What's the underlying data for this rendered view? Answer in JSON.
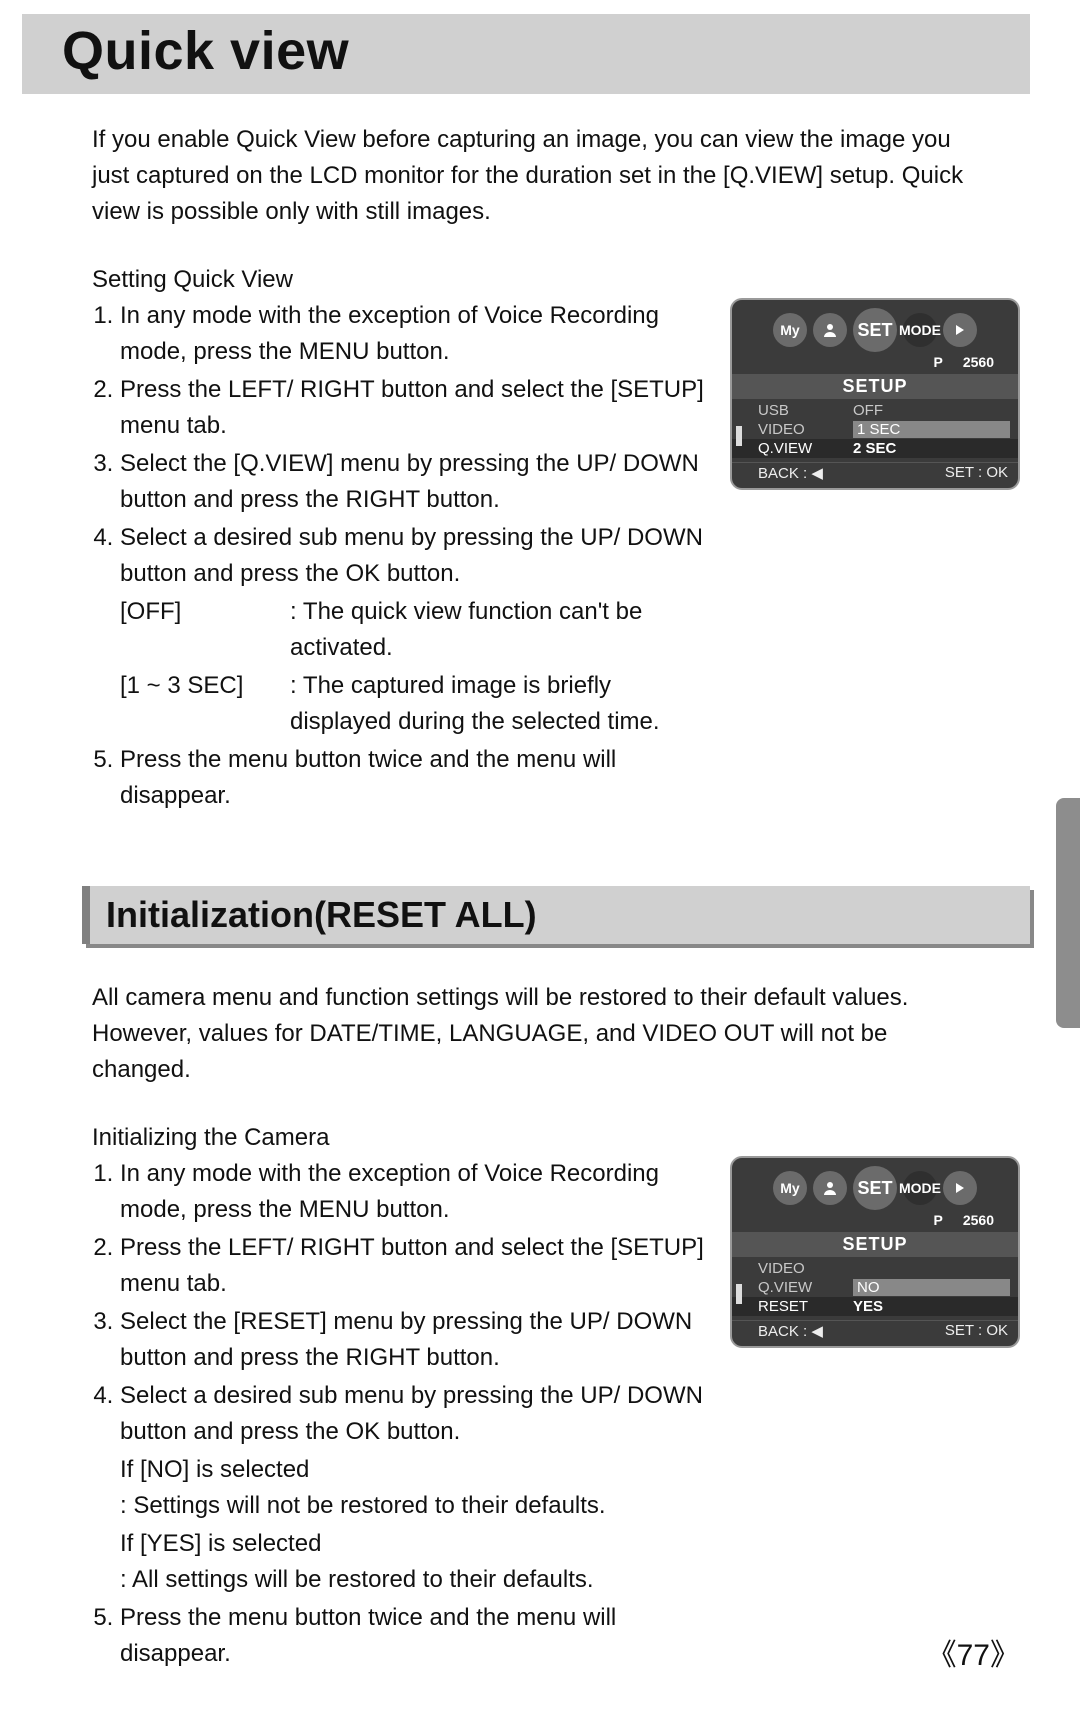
{
  "page_number": "77",
  "section1": {
    "title": "Quick view",
    "intro": "If you enable Quick View before capturing an image, you can view the image you just captured on the LCD monitor for the duration set in the [Q.VIEW] setup. Quick view is possible only with still images.",
    "subtitle": "Setting Quick View",
    "steps": [
      "In any mode with the exception of Voice Recording mode, press the MENU button.",
      "Press the LEFT/ RIGHT button and select the [SETUP] menu tab.",
      "Select the [Q.VIEW] menu by pressing the UP/ DOWN button and press the RIGHT button.",
      "Select a desired sub menu by pressing the UP/ DOWN button and press the OK button.",
      "Press the menu button twice and the menu will disappear."
    ],
    "options": [
      {
        "key": "[OFF]",
        "desc": ": The quick view function can't be activated."
      },
      {
        "key": "[1 ~ 3 SEC]",
        "desc": ": The captured image is briefly displayed during the selected time."
      }
    ]
  },
  "section2": {
    "title": "Initialization(RESET ALL)",
    "intro": "All camera menu and function settings will be restored to their default values. However, values for DATE/TIME, LANGUAGE, and VIDEO OUT will not be changed.",
    "subtitle": "Initializing the Camera",
    "steps": [
      "In any mode with the exception of Voice Recording mode, press the MENU button.",
      "Press the LEFT/ RIGHT button and select the [SETUP] menu tab.",
      "Select the [RESET] menu by pressing the UP/ DOWN button and press the RIGHT button.",
      "Select a desired sub menu by pressing the UP/ DOWN button and press the OK button.",
      "Press the menu button twice and the menu will disappear."
    ],
    "options": [
      {
        "key": "If [NO] is selected",
        "desc": ": Settings will not be restored to their defaults."
      },
      {
        "key": "If [YES] is selected",
        "desc": ": All settings will be restored to their defaults."
      }
    ]
  },
  "lcd1": {
    "set": "SET",
    "mode": "MODE",
    "p": "P",
    "res": "2560",
    "header": "SETUP",
    "rows": [
      {
        "k": "USB",
        "v": "OFF"
      },
      {
        "k": "VIDEO",
        "v": "1 SEC"
      },
      {
        "k": "Q.VIEW",
        "v": "2 SEC"
      }
    ],
    "back": "BACK : ◀",
    "setok": "SET : OK"
  },
  "lcd2": {
    "set": "SET",
    "mode": "MODE",
    "p": "P",
    "res": "2560",
    "header": "SETUP",
    "rows": [
      {
        "k": "VIDEO",
        "v": ""
      },
      {
        "k": "Q.VIEW",
        "v": "NO"
      },
      {
        "k": "RESET",
        "v": "YES"
      }
    ],
    "back": "BACK : ◀",
    "setok": "SET : OK"
  }
}
